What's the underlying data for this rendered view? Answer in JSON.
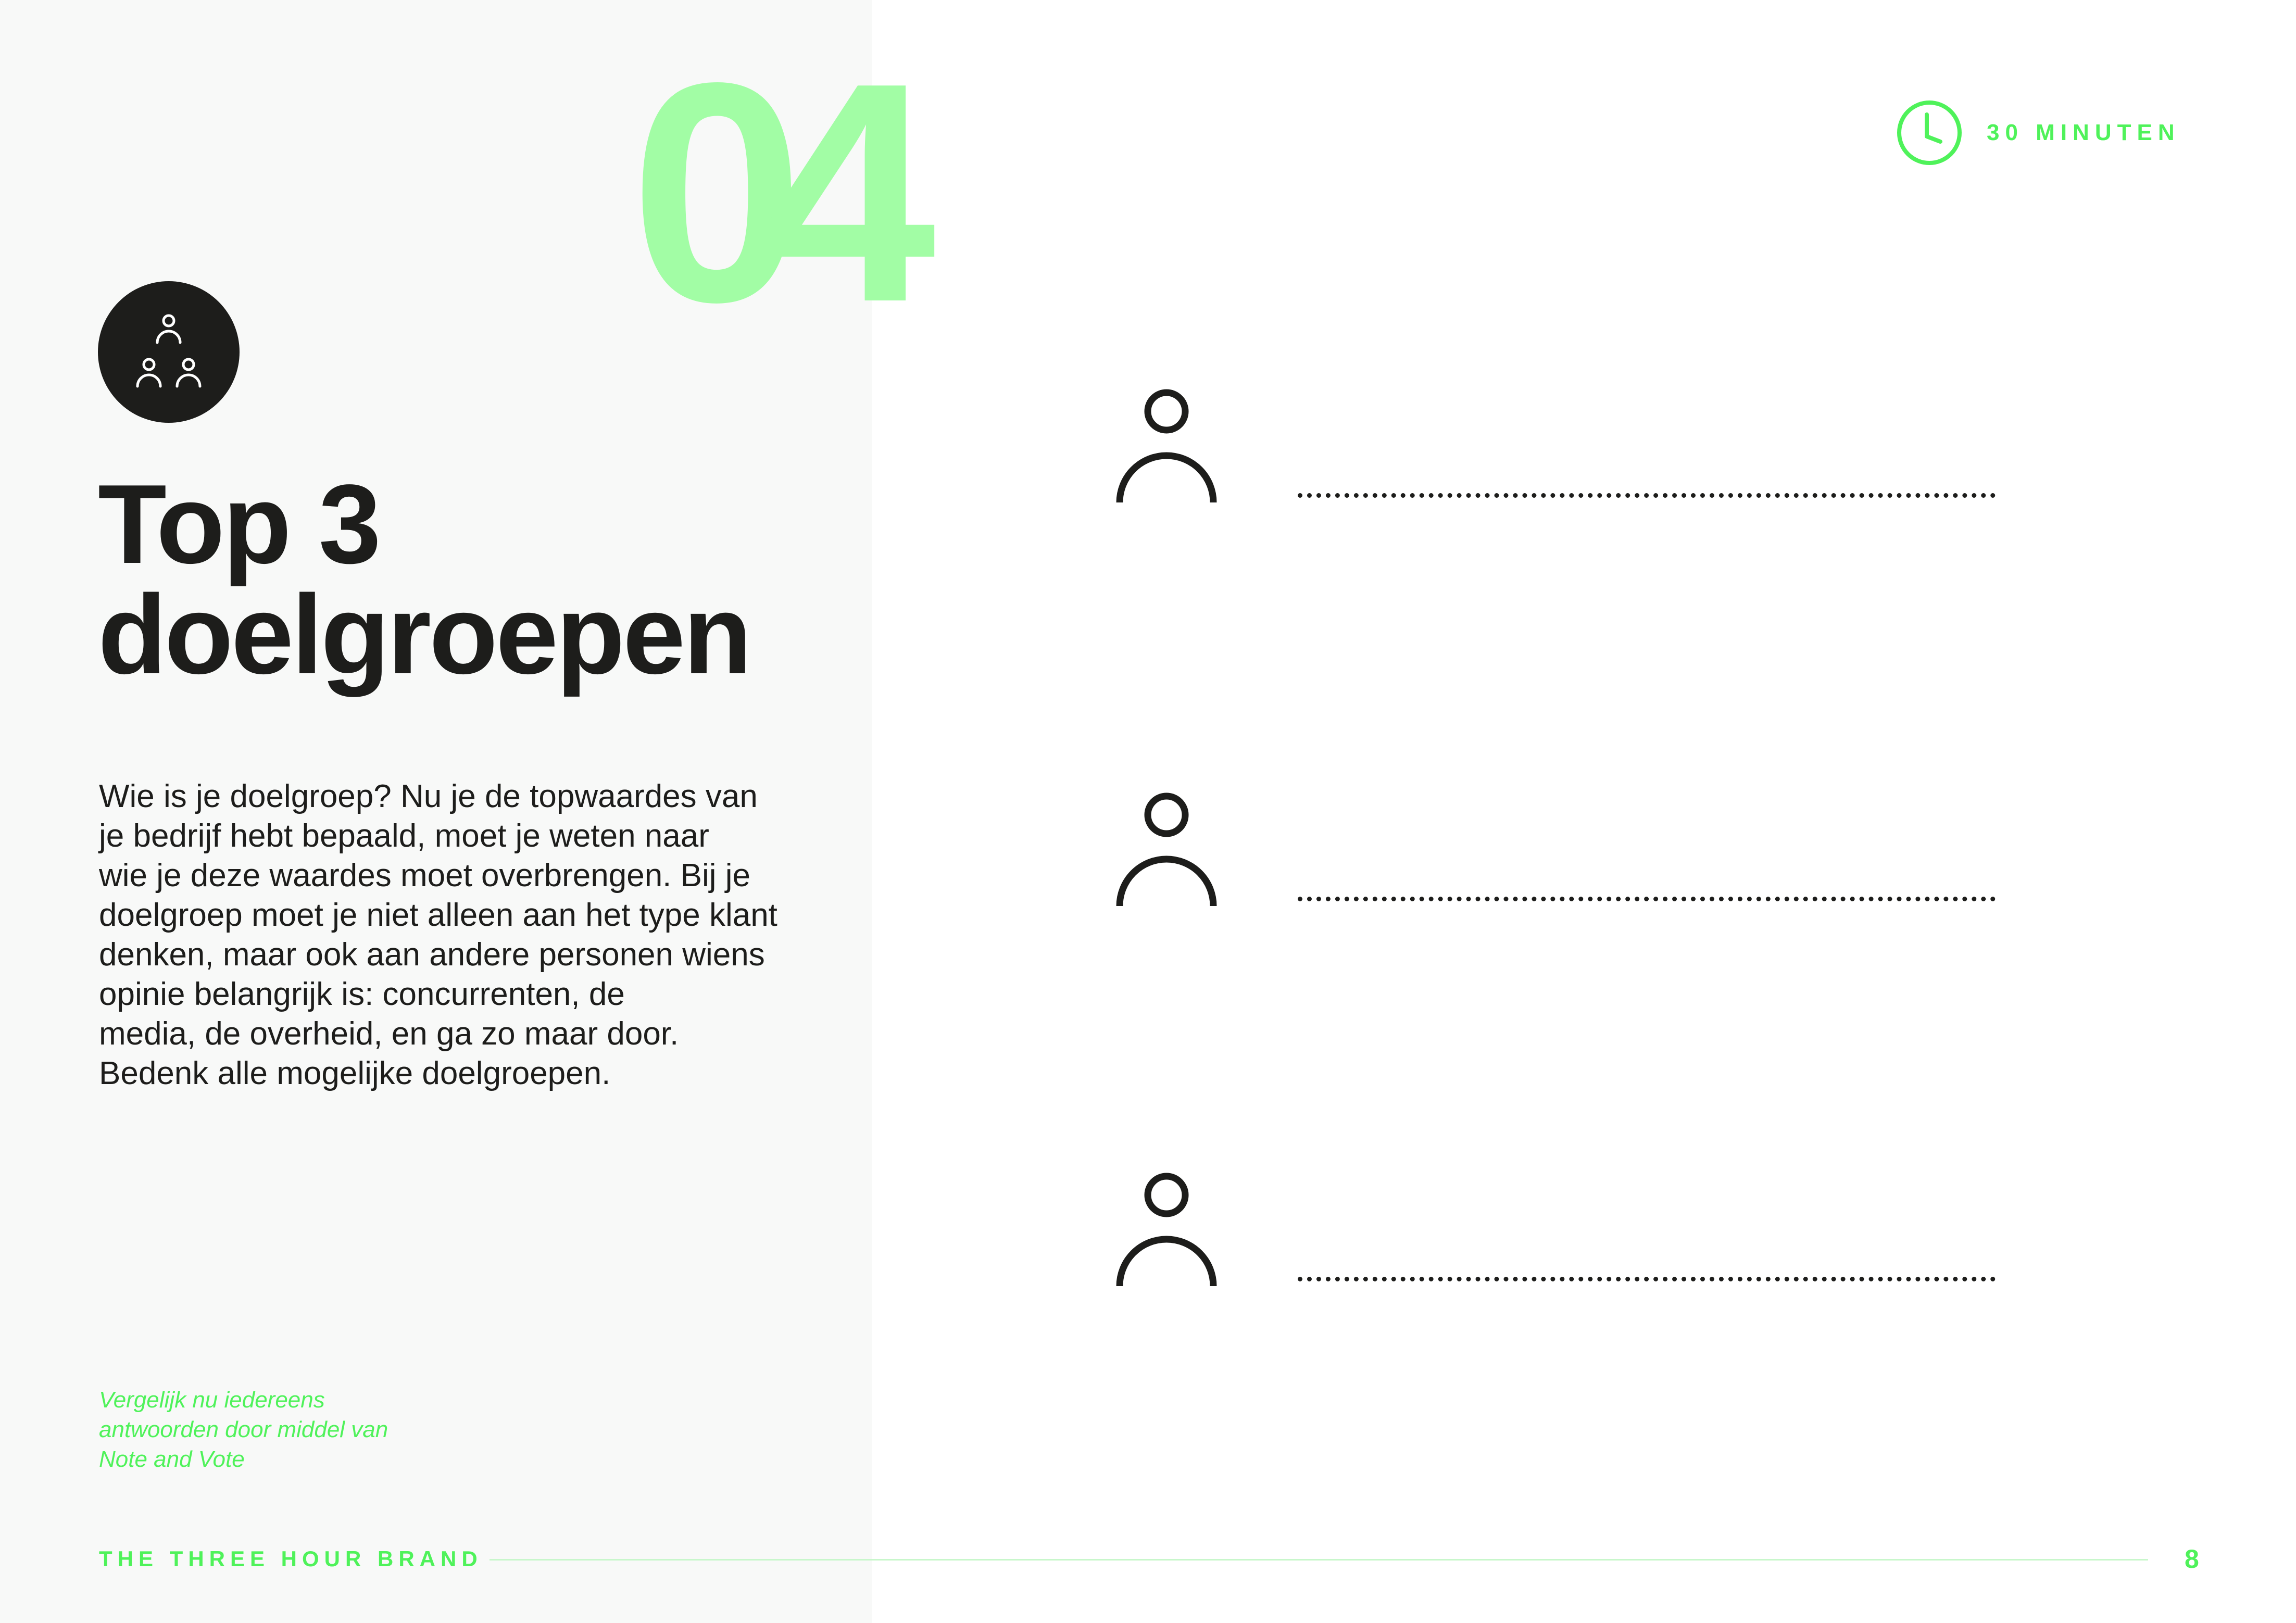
{
  "step": {
    "number": "04"
  },
  "timer": {
    "label": "30 MINUTEN",
    "icon": "clock-icon"
  },
  "badge": {
    "icon": "group-people-icon"
  },
  "title": {
    "line1": "Top 3",
    "line2": "doelgroepen"
  },
  "description": {
    "lines": [
      "Wie is je doelgroep? Nu je de topwaardes van",
      "je bedrijf hebt bepaald, moet je weten naar",
      "wie je deze waardes moet overbrengen. Bij je",
      "doelgroep moet je niet alleen aan het type klant",
      "denken, maar ook aan andere personen wiens",
      "opinie belangrijk is: concurrenten, de",
      "media, de overheid, en ga zo maar door.",
      "Bedenk alle mogelijke doelgroepen."
    ]
  },
  "note": {
    "lines": [
      "Vergelijk nu iedereens",
      "antwoorden door middel van",
      "Note and Vote"
    ]
  },
  "entries": [
    {
      "icon": "person-icon"
    },
    {
      "icon": "person-icon"
    },
    {
      "icon": "person-icon"
    }
  ],
  "footer": {
    "brand": "THE THREE HOUR BRAND",
    "page": "8"
  },
  "colors": {
    "accent": "#a2fda5",
    "accent_text": "#4ff25a",
    "dark": "#1d1d1b",
    "panel": "#f8f9f8"
  }
}
